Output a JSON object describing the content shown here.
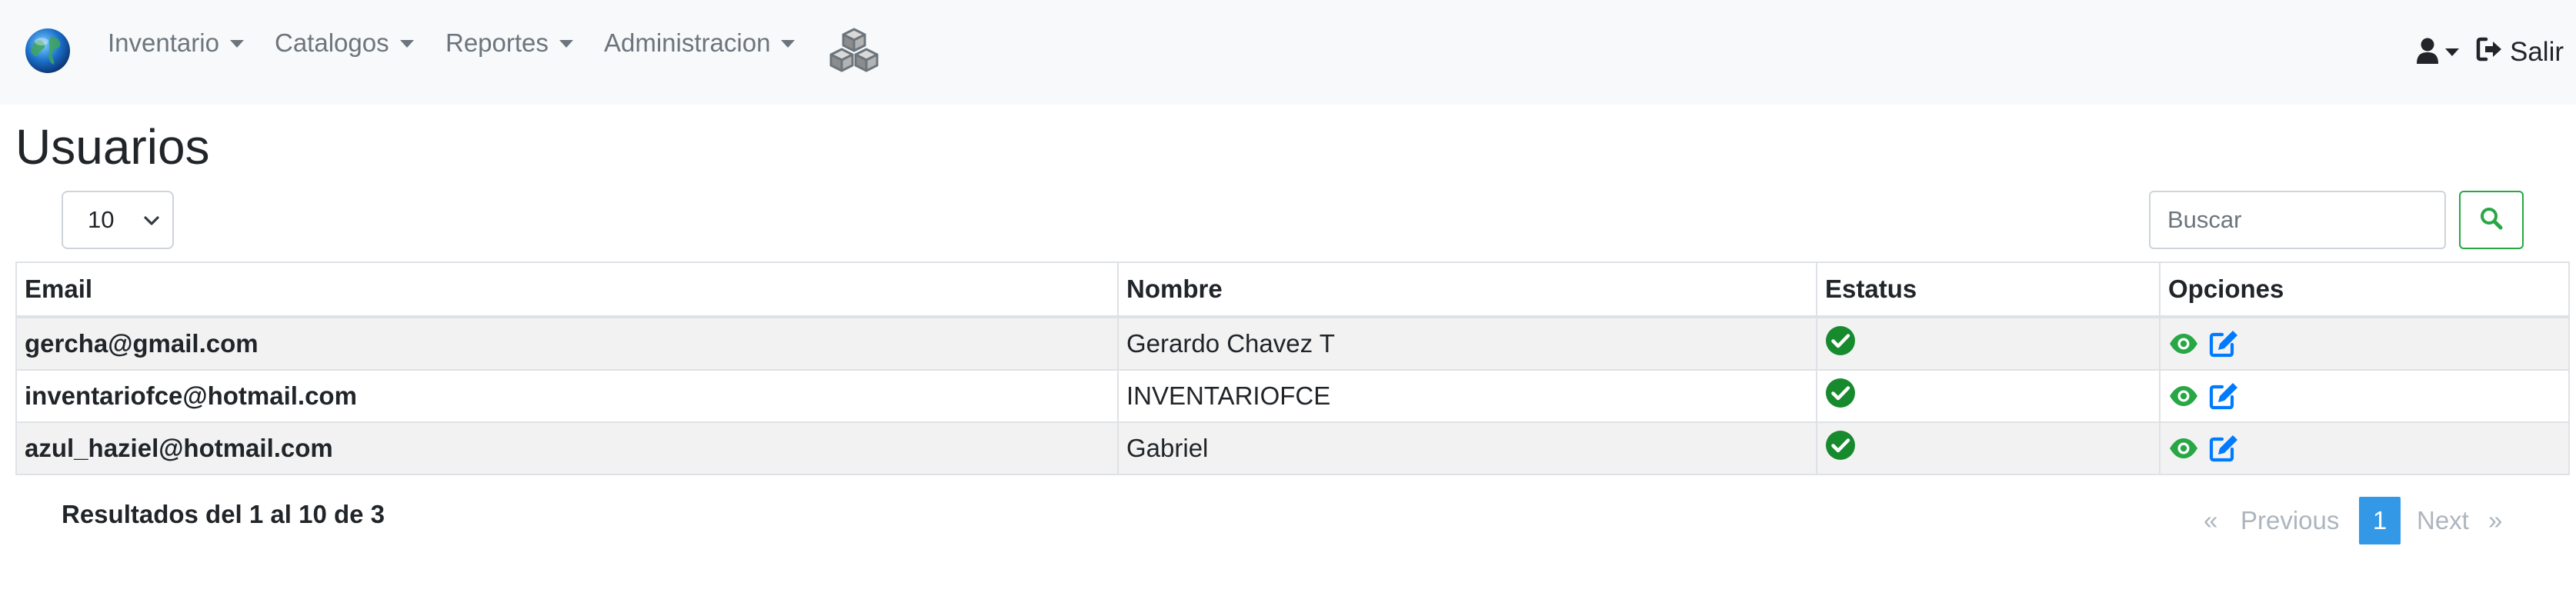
{
  "navbar": {
    "menus": [
      {
        "label": "Inventario"
      },
      {
        "label": "Catalogos"
      },
      {
        "label": "Reportes"
      },
      {
        "label": "Administracion"
      }
    ],
    "logout_label": "Salir"
  },
  "page": {
    "title": "Usuarios"
  },
  "controls": {
    "page_size": "10",
    "search_placeholder": "Buscar"
  },
  "table": {
    "headers": [
      "Email",
      "Nombre",
      "Estatus",
      "Opciones"
    ],
    "rows": [
      {
        "email": "gercha@gmail.com",
        "nombre": "Gerardo Chavez T",
        "estatus": "active"
      },
      {
        "email": "inventariofce@hotmail.com",
        "nombre": "INVENTARIOFCE",
        "estatus": "active"
      },
      {
        "email": "azul_haziel@hotmail.com",
        "nombre": "Gabriel",
        "estatus": "active"
      }
    ]
  },
  "footer": {
    "results_text": "Resultados del 1 al 10 de 3",
    "pagination": {
      "prev_arrow": "«",
      "prev_label": "Previous",
      "current_page": "1",
      "next_label": "Next",
      "next_arrow": "»"
    }
  },
  "colors": {
    "navbar_bg": "#f8f9fa",
    "success": "#28a745",
    "status_check": "#178a2e",
    "edit": "#007bff",
    "active_page": "#3399e6"
  },
  "icons": {
    "brand": "globe-icon",
    "cubes": "boxes-icon",
    "user": "user-icon",
    "logout": "sign-out-icon",
    "search": "search-icon",
    "status": "check-circle-icon",
    "view": "eye-icon",
    "edit": "edit-icon"
  }
}
